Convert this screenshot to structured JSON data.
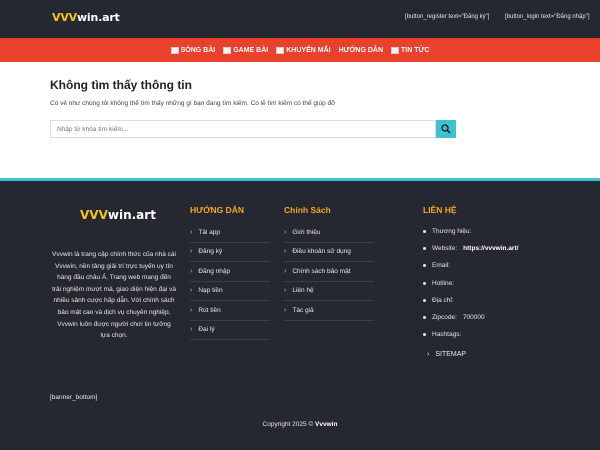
{
  "header": {
    "logo_prefix": "VVV",
    "logo_suffix": "win.art",
    "register_text": "[button_register text=\"Đăng ký\"]",
    "login_text": "[button_login text=\"Đăng nhập\"]"
  },
  "nav": {
    "items": [
      {
        "label": "SÒNG BÀI",
        "has_icon": true
      },
      {
        "label": "GAME BÀI",
        "has_icon": true
      },
      {
        "label": "KHUYẾN MÃI",
        "has_icon": true
      },
      {
        "label": "HƯỚNG DẪN",
        "has_icon": false
      },
      {
        "label": "TIN TỨC",
        "has_icon": true
      }
    ]
  },
  "main": {
    "title": "Không tìm thấy thông tin",
    "description": "Có vẻ như chúng tôi không thể tìm thấy những gì bạn đang tìm kiếm. Có lẽ tìm kiếm có thể giúp đỡ",
    "search_placeholder": "Nhập từ khóa tìm kiếm..."
  },
  "footer": {
    "logo_prefix": "VVV",
    "logo_suffix": "win.art",
    "description": "Vvvwin là trang cập chính thức của nhà cái Vvvwin, nền tảng giải trí trực tuyến uy tín hàng đầu châu Á. Trang web mang đến trải nghiệm mượt mà, giao diện hiện đại và nhiều sảnh cược hấp dẫn. Với chính sách bảo mật cao và dịch vụ chuyên nghiệp, Vvvwin luôn được người chơi tin tưởng lựa chọn.",
    "guide": {
      "title": "HƯỚNG DẪN",
      "items": [
        "Tải app",
        "Đăng ký",
        "Đăng nhập",
        "Nạp tiền",
        "Rút tiền",
        "Đại lý"
      ]
    },
    "policy": {
      "title": "Chính Sách",
      "items": [
        "Giới thiệu",
        "Điều khoản sử dụng",
        "Chính sách bảo mật",
        "Liên hệ",
        "Tác giả"
      ]
    },
    "contact": {
      "title": "LIÊN HỆ",
      "items": [
        {
          "label": "Thương hiệu:",
          "value": ""
        },
        {
          "label": "Website:",
          "value": "https://vvvwin.art/"
        },
        {
          "label": "Email:",
          "value": ""
        },
        {
          "label": "Hotline:",
          "value": ""
        },
        {
          "label": "Địa chỉ:",
          "value": ""
        },
        {
          "label": "Zipcode:",
          "value": "700000"
        },
        {
          "label": "Hashtags:",
          "value": ""
        }
      ],
      "sitemap": "SITEMAP"
    },
    "banner_bottom": "[banner_bottom]",
    "copyright_prefix": "Copyright 2025 © ",
    "copyright_brand": "Vvvwin"
  },
  "colors": {
    "dark_bg": "#252830",
    "nav_red": "#e9412b",
    "accent_cyan": "#3cc3cf",
    "logo_yellow": "#f5c518",
    "heading_orange": "#f5a623"
  },
  "icons": {
    "search_button": "search-icon",
    "nav_item": "image-placeholder-icon",
    "list_item": "chevron-right-icon",
    "contact_item": "bullet-icon"
  }
}
